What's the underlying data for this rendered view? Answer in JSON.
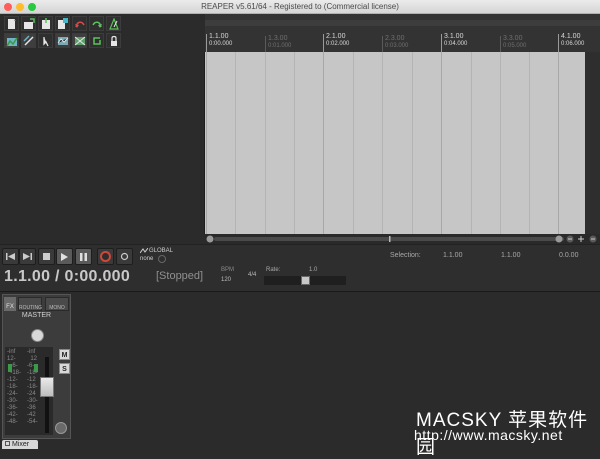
{
  "window": {
    "title": "REAPER v5.61/64 - Registered to  (Commercial license)"
  },
  "ruler": {
    "marks": [
      {
        "measure": "1.1.00",
        "time": "0:00.000",
        "major": true
      },
      {
        "measure": "1.3.00",
        "time": "0:01.000",
        "major": false
      },
      {
        "measure": "2.1.00",
        "time": "0:02.000",
        "major": true
      },
      {
        "measure": "2.3.00",
        "time": "0:03.000",
        "major": false
      },
      {
        "measure": "3.1.00",
        "time": "0:04.000",
        "major": true
      },
      {
        "measure": "3.3.00",
        "time": "0:05.000",
        "major": false
      },
      {
        "measure": "4.1.00",
        "time": "0:06.000",
        "major": true
      }
    ]
  },
  "transport": {
    "position": "1.1.00 / 0:00.000",
    "status": "[Stopped]",
    "global_label": "GLOBAL",
    "global_mode": "none",
    "bpm_label": "BPM",
    "bpm_value": "120",
    "time_sig": "4/4",
    "rate_label": "Rate:",
    "rate_value": "1.0",
    "rate_level": 0.5,
    "selection_label": "Selection:",
    "selection_start": "1.1.00",
    "selection_end": "1.1.00",
    "selection_length": "0.0.00"
  },
  "mixer": {
    "master_label": "MASTER",
    "fx_label": "FX",
    "routing_label": "ROUTING",
    "mono_label": "MONO",
    "mute_label": "M",
    "solo_label": "S",
    "meter_left": "-inf\n12-\n  -6-\n  -18-\n-12-\n-18-\n-24-\n-30-\n-36-\n-42-\n-48-\n",
    "meter_right": "-inf\n  12\n-6-\n-18-\n-12\n-18-\n-24\n-30-\n-36\n-42\n-54-\n",
    "tab_label": "Mixer"
  },
  "watermark": {
    "line1": "MACSKY 苹果软件园",
    "line2": "http://www.macsky.net"
  },
  "colors": {
    "arrange_bg": "#c6c6c6",
    "record": "#c94a3c",
    "panel_bg": "#2b2b2b"
  }
}
